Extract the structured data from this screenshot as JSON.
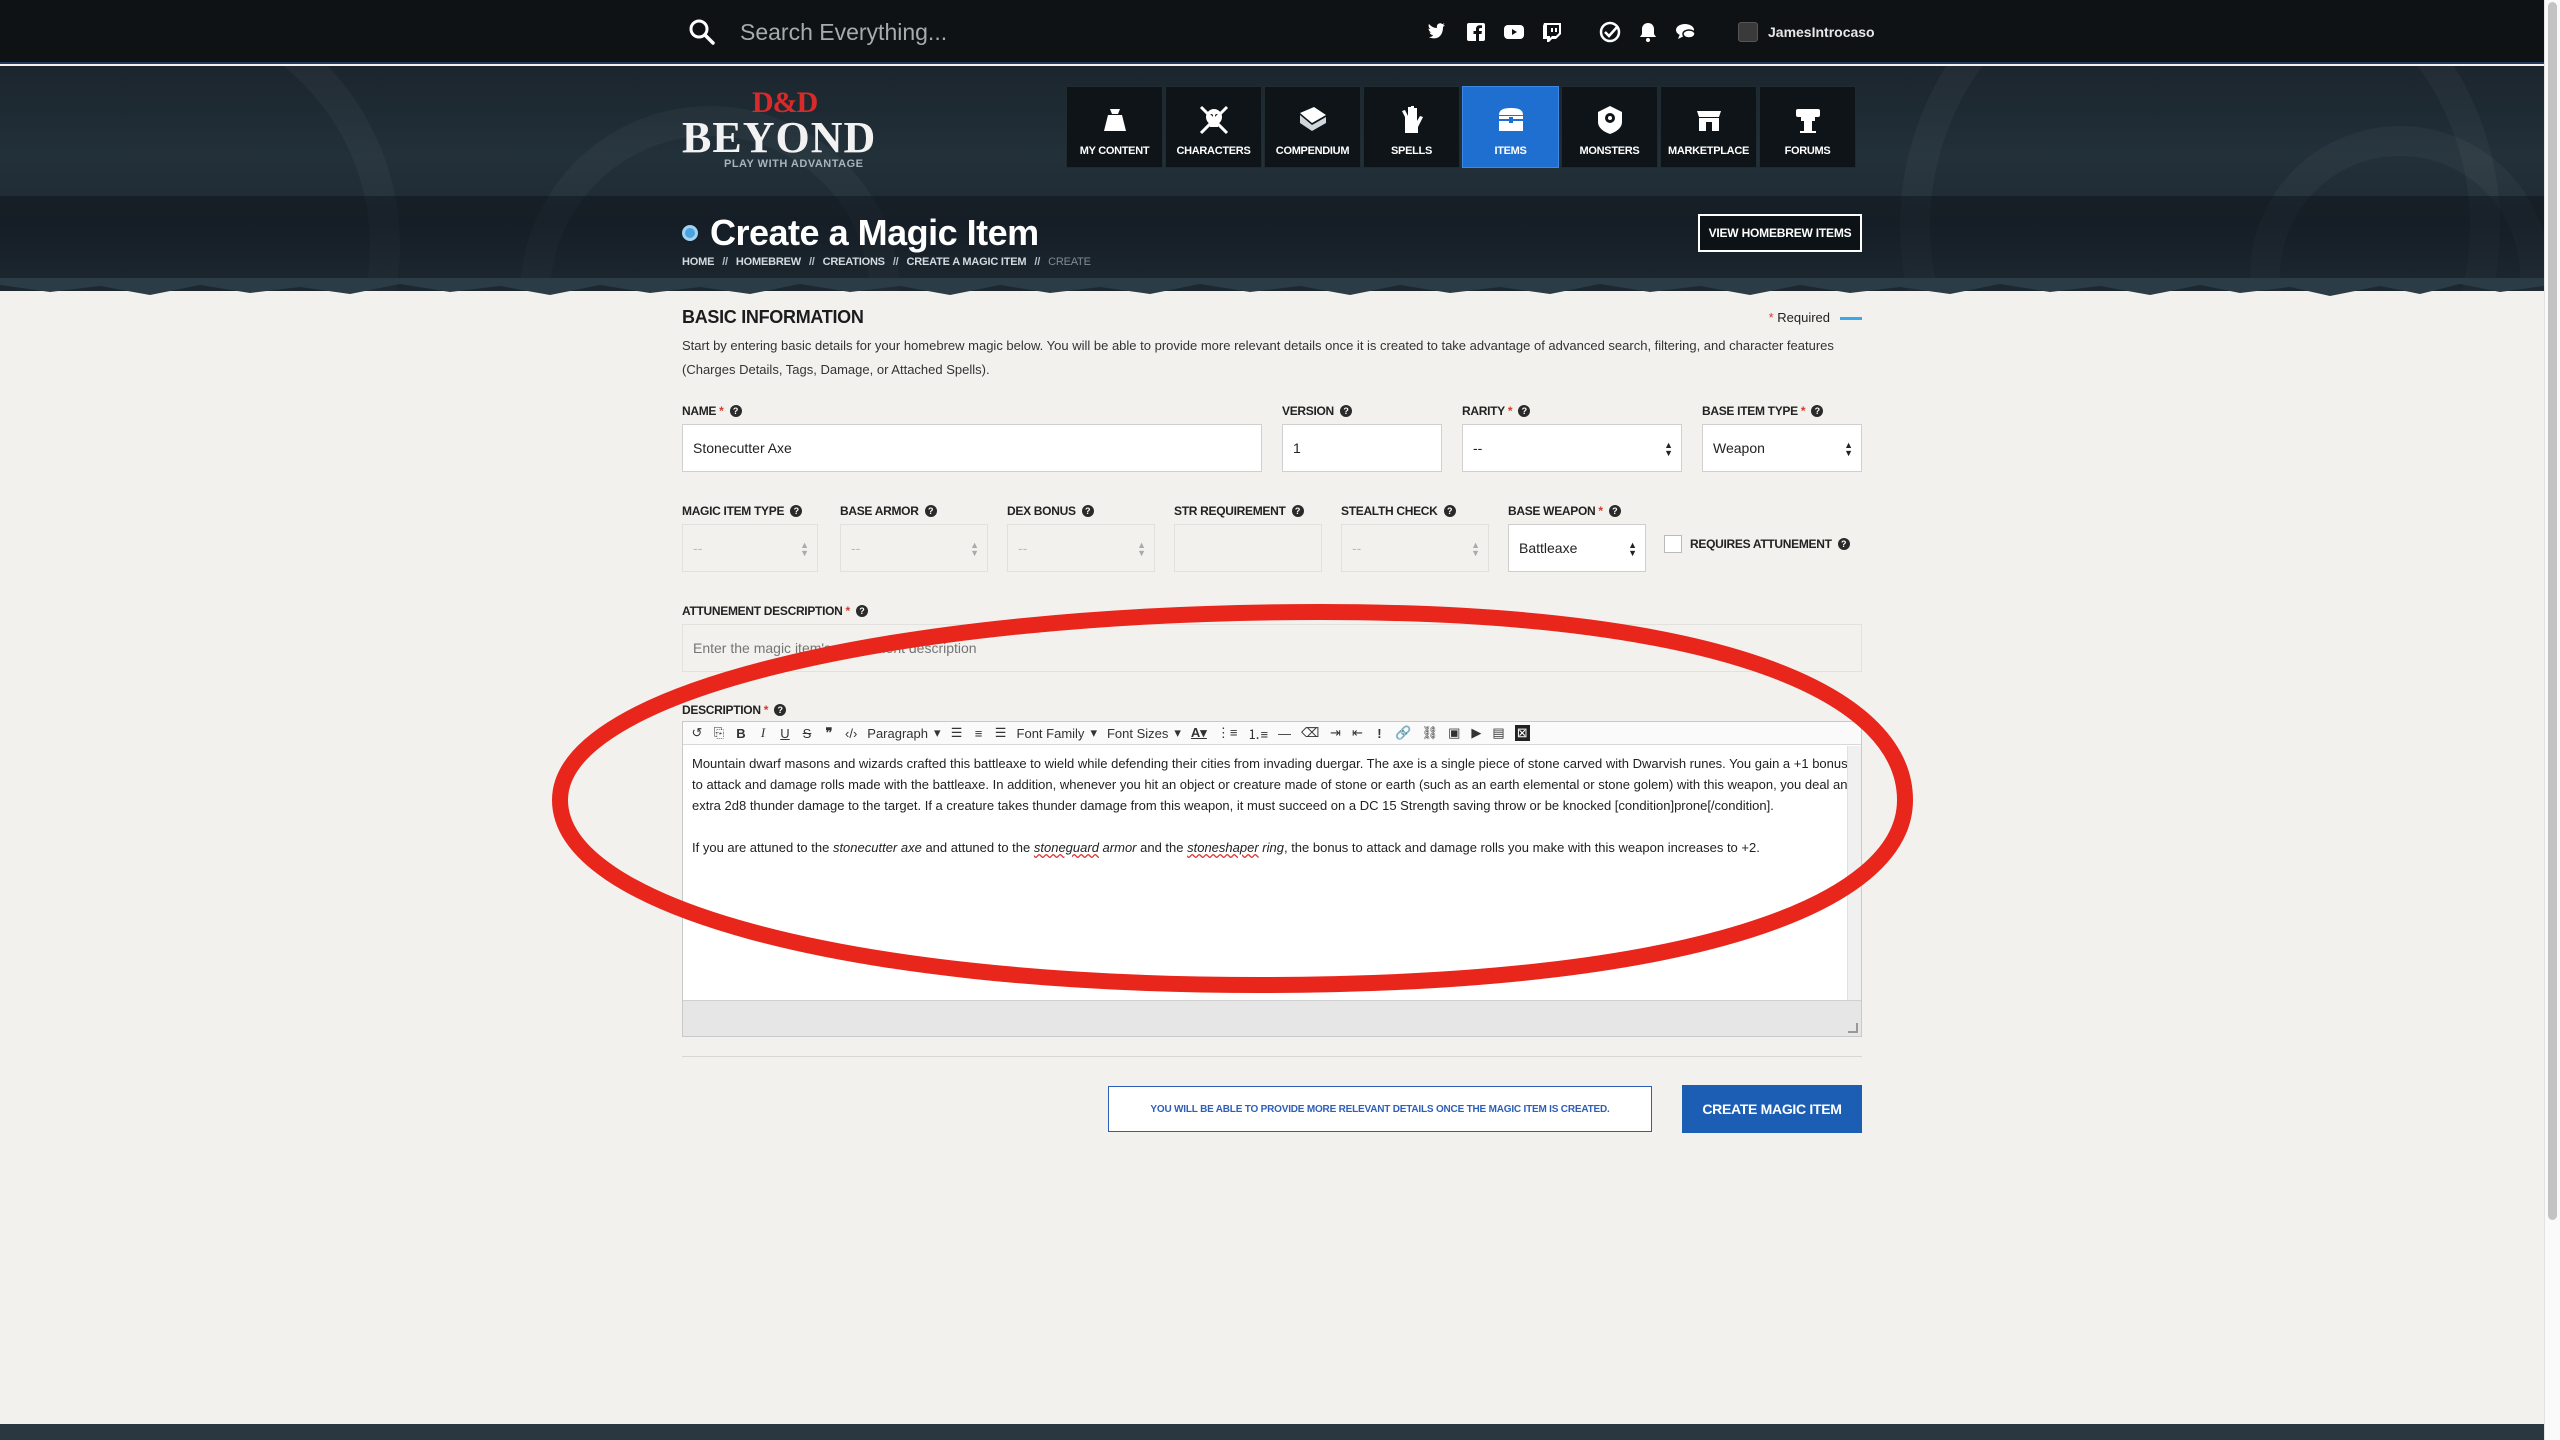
{
  "search": {
    "placeholder": "Search Everything..."
  },
  "social_icons": [
    "twitter-icon",
    "facebook-icon",
    "youtube-icon",
    "twitch-icon"
  ],
  "user": {
    "name": "JamesIntrocaso"
  },
  "logo": {
    "dnd": "D&D",
    "beyond": "BEYOND",
    "tagline": "PLAY WITH ADVANTAGE"
  },
  "nav": [
    {
      "label": "MY CONTENT",
      "icon": "bag-icon"
    },
    {
      "label": "CHARACTERS",
      "icon": "skull-crossbones-icon"
    },
    {
      "label": "COMPENDIUM",
      "icon": "book-icon"
    },
    {
      "label": "SPELLS",
      "icon": "hand-magic-icon"
    },
    {
      "label": "ITEMS",
      "icon": "chest-icon",
      "active": true
    },
    {
      "label": "MONSTERS",
      "icon": "monster-icon"
    },
    {
      "label": "MARKETPLACE",
      "icon": "shop-icon"
    },
    {
      "label": "FORUMS",
      "icon": "forum-icon"
    }
  ],
  "page": {
    "title": "Create a Magic Item",
    "breadcrumb": [
      "HOME",
      "HOMEBREW",
      "CREATIONS",
      "CREATE A MAGIC ITEM",
      "CREATE"
    ],
    "breadcrumb_sep": "//",
    "view_homebrew_label": "VIEW HOMEBREW ITEMS"
  },
  "form": {
    "section_title": "BASIC INFORMATION",
    "required_label": "Required",
    "intro": "Start by entering basic details for your homebrew magic below. You will be able to provide more relevant details once it is created to take advantage of advanced search, filtering, and character features (Charges Details, Tags, Damage, or Attached Spells).",
    "name": {
      "label": "NAME",
      "value": "Stonecutter Axe"
    },
    "version": {
      "label": "VERSION",
      "value": "1"
    },
    "rarity": {
      "label": "RARITY",
      "value": "--"
    },
    "base_item_type": {
      "label": "BASE ITEM TYPE",
      "value": "Weapon"
    },
    "magic_item_type": {
      "label": "MAGIC ITEM TYPE",
      "value": "--"
    },
    "base_armor": {
      "label": "BASE ARMOR",
      "value": "--"
    },
    "dex_bonus": {
      "label": "DEX BONUS",
      "value": "--"
    },
    "str_requirement": {
      "label": "STR REQUIREMENT",
      "value": ""
    },
    "stealth_check": {
      "label": "STEALTH CHECK",
      "value": "--"
    },
    "base_weapon": {
      "label": "BASE WEAPON",
      "value": "Battleaxe"
    },
    "requires_attunement": {
      "label": "REQUIRES ATTUNEMENT",
      "checked": false
    },
    "attunement_description": {
      "label": "ATTUNEMENT DESCRIPTION",
      "placeholder": "Enter the magic item's attunement description"
    },
    "description": {
      "label": "DESCRIPTION",
      "toolbar": {
        "paragraph": "Paragraph",
        "font_family": "Font Family",
        "font_sizes": "Font Sizes"
      },
      "p1": "Mountain dwarf masons and wizards crafted this battleaxe to wield while defending their cities from invading duergar. The axe is a single piece of stone carved with Dwarvish runes. You gain a +1 bonus to attack and damage rolls made with the battleaxe. In addition, whenever you hit an object or creature made of stone or earth (such as an earth elemental or stone golem) with this weapon, you deal an extra 2d8 thunder damage to the target. If a creature takes thunder damage from this weapon, it must succeed on a DC 15 Strength saving throw or be knocked [condition]prone[/condition].",
      "p2_a": "If you are attuned to the ",
      "p2_i1": "stonecutter axe",
      "p2_b": " and attuned to the ",
      "p2_i2": "stoneguard",
      "p2_i2b": " armor",
      "p2_c": " and the ",
      "p2_i3": "stoneshaper",
      "p2_i3b": " ring",
      "p2_d": ", the bonus to attack and damage rolls you make with this weapon increases to +2."
    },
    "notice": "YOU WILL BE ABLE TO PROVIDE MORE RELEVANT DETAILS ONCE THE MAGIC ITEM IS CREATED.",
    "submit_label": "CREATE MAGIC ITEM"
  },
  "colors": {
    "accent": "#1b5eb4",
    "nav_active": "#1f6fd1",
    "required": "#d33a2c",
    "annotation": "#e8261c"
  }
}
